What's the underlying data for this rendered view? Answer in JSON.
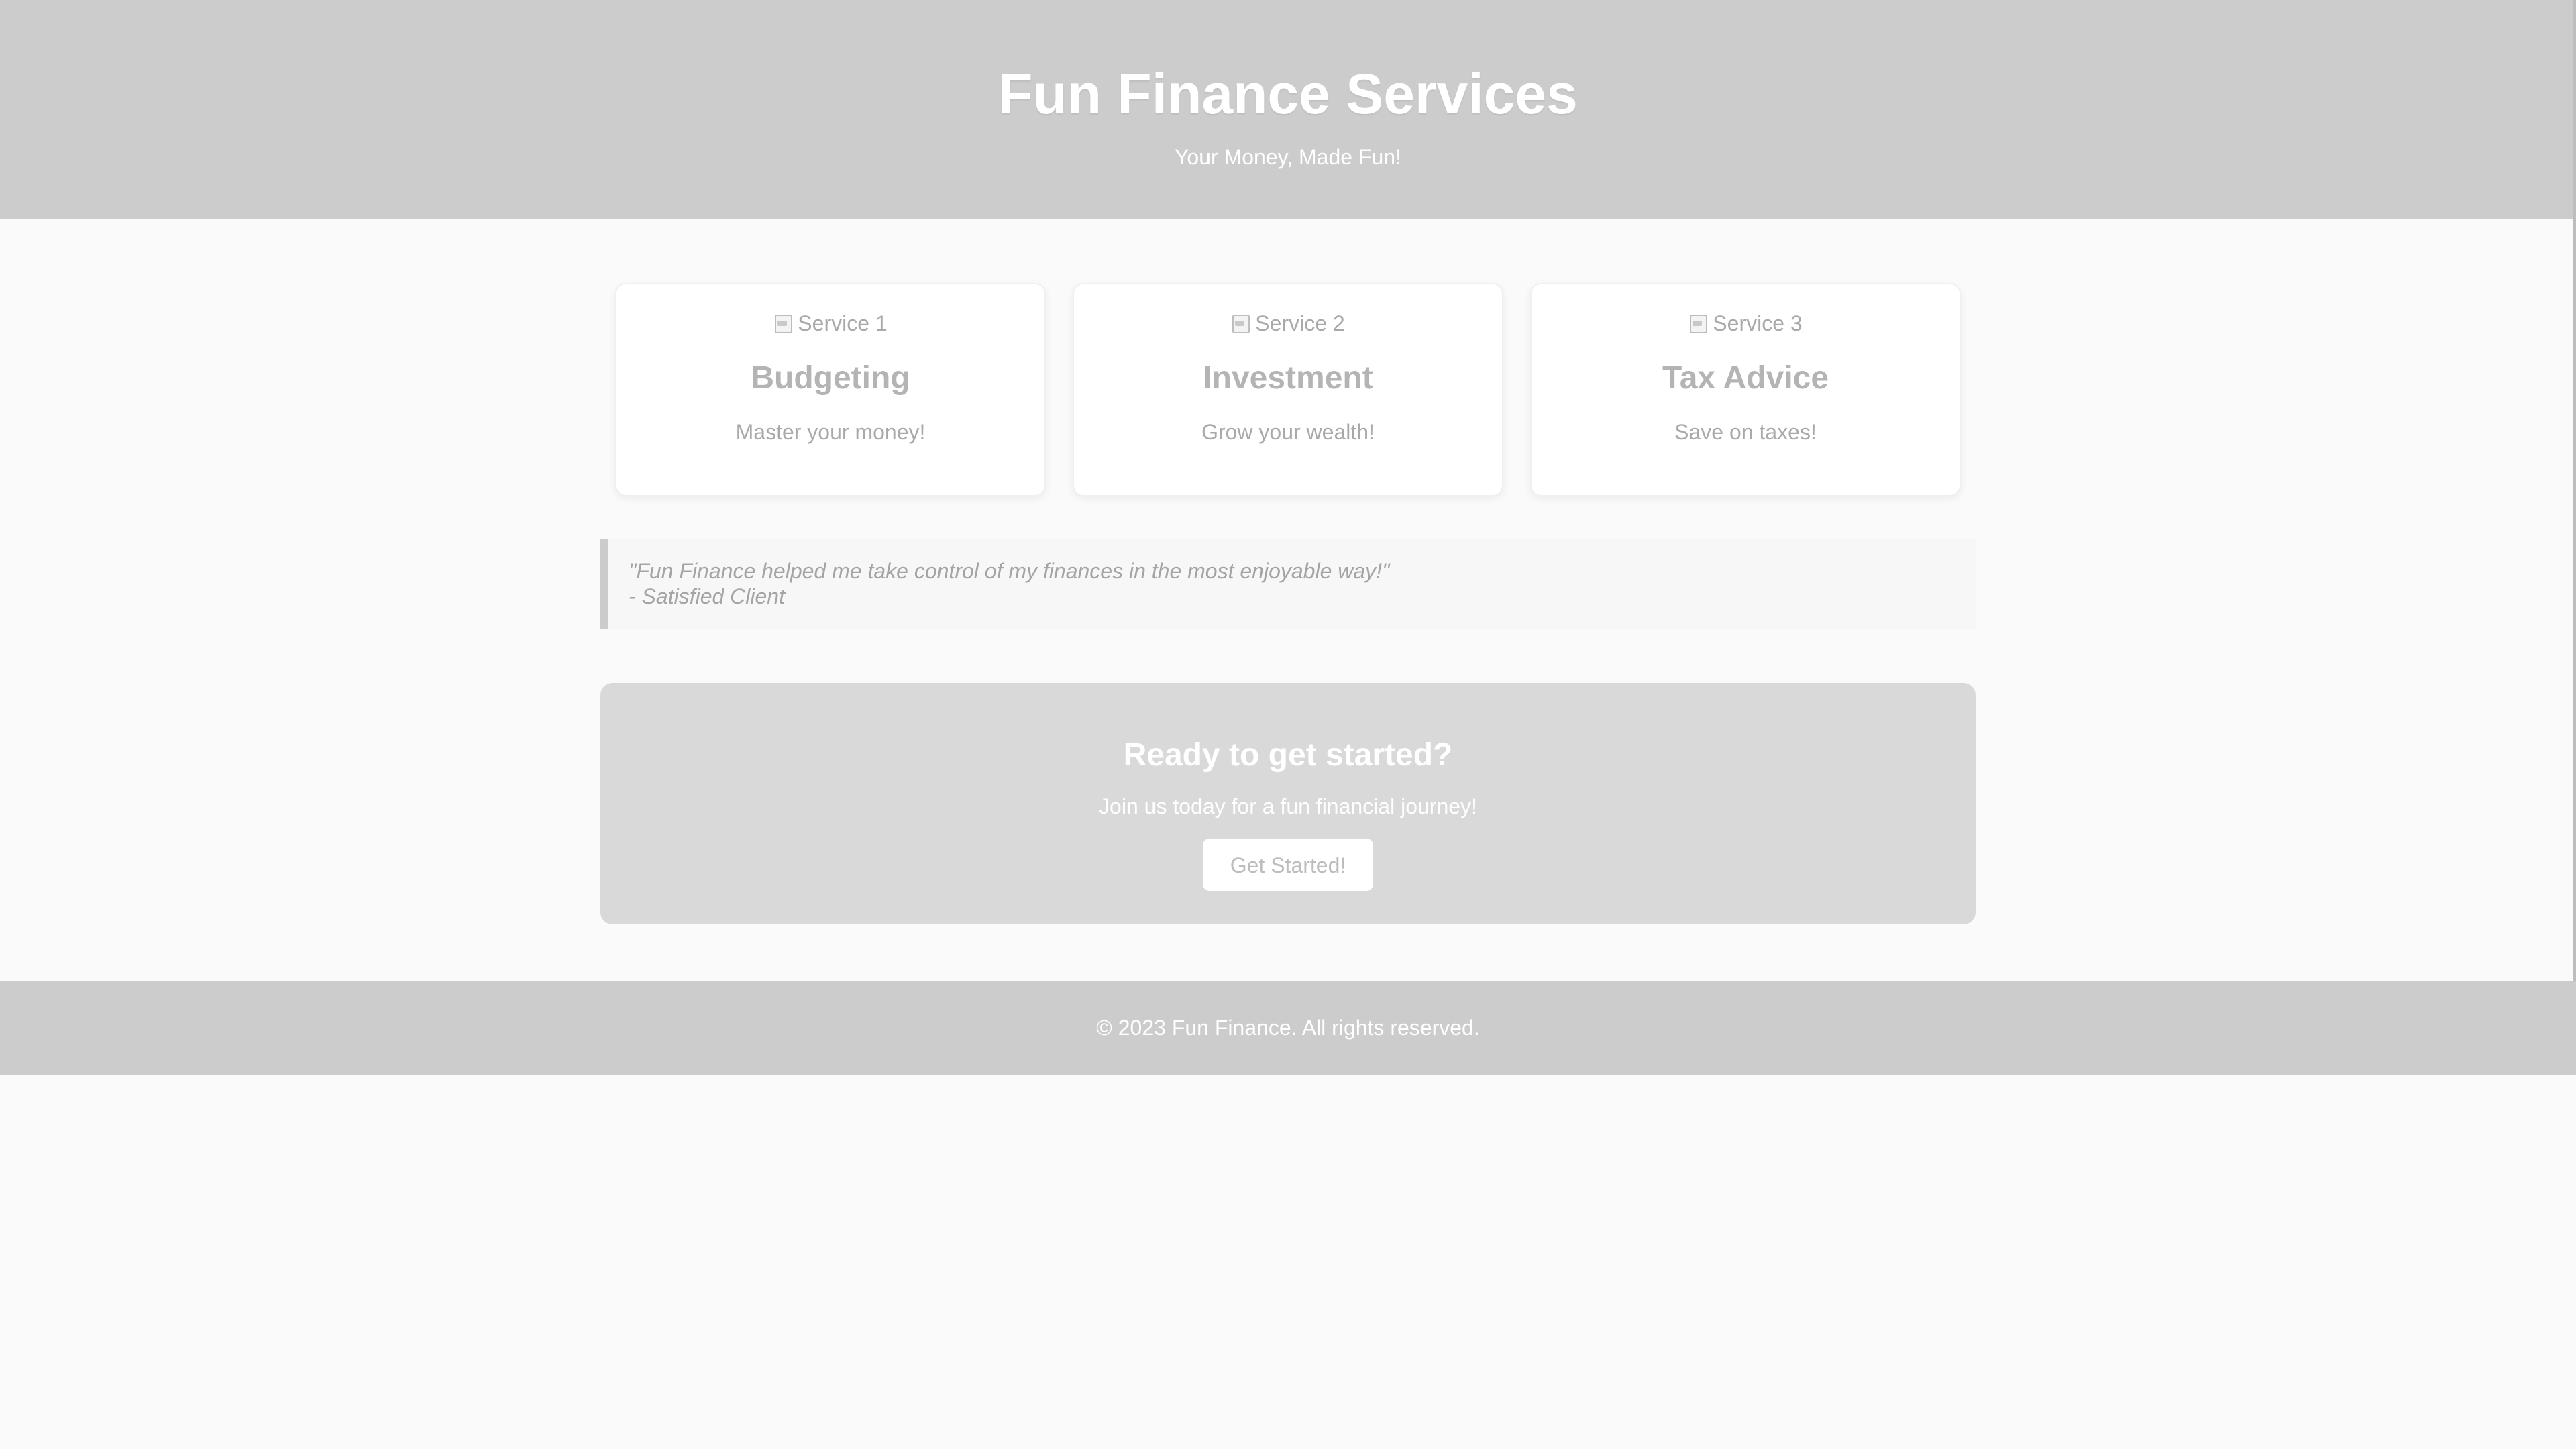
{
  "header": {
    "title": "Fun Finance Services",
    "subtitle": "Your Money, Made Fun!"
  },
  "services": [
    {
      "image_alt": "Service 1",
      "title": "Budgeting",
      "description": "Master your money!"
    },
    {
      "image_alt": "Service 2",
      "title": "Investment",
      "description": "Grow your wealth!"
    },
    {
      "image_alt": "Service 3",
      "title": "Tax Advice",
      "description": "Save on taxes!"
    }
  ],
  "testimonial": {
    "quote": "\"Fun Finance helped me take control of my finances in the most enjoyable way!\"",
    "author": "- Satisfied Client"
  },
  "cta": {
    "title": "Ready to get started?",
    "text": "Join us today for a fun financial journey!",
    "button_label": "Get Started!"
  },
  "footer": {
    "text": "© 2023 Fun Finance. All rights reserved."
  },
  "colors": {
    "header_background": "#cccccc",
    "page_background": "#fafafa",
    "cta_background": "#d9d9d9",
    "card_background": "#ffffff"
  },
  "icons": {
    "service_image": "broken-image-icon"
  }
}
